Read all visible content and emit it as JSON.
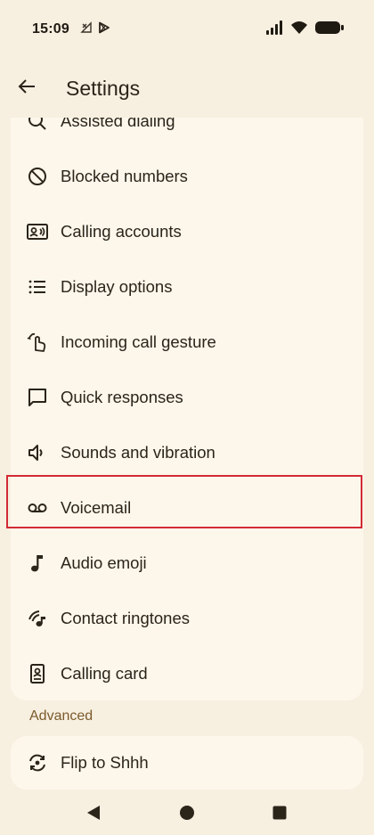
{
  "status_bar": {
    "time": "15:09"
  },
  "app_bar": {
    "title": "Settings"
  },
  "settings": {
    "items": [
      {
        "label": "Assisted dialing",
        "icon": "assisted-dialing-icon"
      },
      {
        "label": "Blocked numbers",
        "icon": "block-icon"
      },
      {
        "label": "Calling accounts",
        "icon": "contact-card-icon"
      },
      {
        "label": "Display options",
        "icon": "list-icon"
      },
      {
        "label": "Incoming call gesture",
        "icon": "gesture-icon"
      },
      {
        "label": "Quick responses",
        "icon": "chat-bubble-icon"
      },
      {
        "label": "Sounds and vibration",
        "icon": "speaker-icon"
      },
      {
        "label": "Voicemail",
        "icon": "voicemail-icon"
      },
      {
        "label": "Audio emoji",
        "icon": "music-note-icon"
      },
      {
        "label": "Contact ringtones",
        "icon": "ringtone-icon"
      },
      {
        "label": "Calling card",
        "icon": "calling-card-icon"
      }
    ],
    "advanced_header": "Advanced",
    "advanced_items": [
      {
        "label": "Flip to Shhh",
        "icon": "flip-phone-icon"
      }
    ]
  },
  "colors": {
    "background": "#f7efe0",
    "card": "#fdf7eb",
    "text": "#2b2419",
    "section_header": "#7a5a2c",
    "highlight": "#d22a35"
  }
}
